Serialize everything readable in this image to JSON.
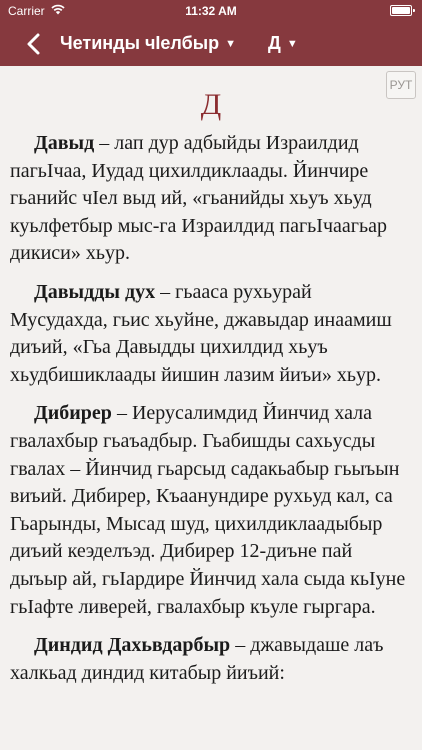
{
  "status_bar": {
    "carrier": "Carrier",
    "time": "11:32 AM"
  },
  "nav": {
    "title": "Четинды чIелбыр",
    "letter": "Д"
  },
  "lang_button": "РУТ",
  "section_letter": "Д",
  "entries": [
    {
      "term": "Давыд",
      "definition": " – лап дур адбыйды Израилдид пагьIчаа, Иудад цихилдиклаады. Йинчире гьанийс чIел выд ий, «гьанийды хьуъ хьуд куьлфетбыр мыс-га Израилдид пагьIчаагьар дикиси» хьур."
    },
    {
      "term": "Давыдды дух",
      "definition": " – гьааса рухьурай Мусудахда, гьис хьуйне, джавыдар инаамиш диъий, «Гьа Давыдды цихилдид хьуъ хьудбишиклаады йишин лазим йиъи» хьур."
    },
    {
      "term": "Дибирер",
      "definition": " – Иерусалимдид Йинчид хала гвалахбыр гьаъадбыр. Гьабишды сахьусды гвалах – Йинчид гьарсыд садакьабыр гьыъын виъий. Дибирер, Къаанундире рухьуд кал, са Гьарынды, Мысад шуд, цихилдиклаадыбыр диъий кеэделъэд. Дибирер 12-диъне пай дыъыр ай, гьIардире Йинчид хала сыда кьIуне гьIафте ливерей, гвалахбыр къуле гыргара."
    },
    {
      "term": "Диндид Дахьвдарбыр",
      "definition": " – джавыдаше лаъ халкьад диндид китабыр йиъий:"
    }
  ]
}
